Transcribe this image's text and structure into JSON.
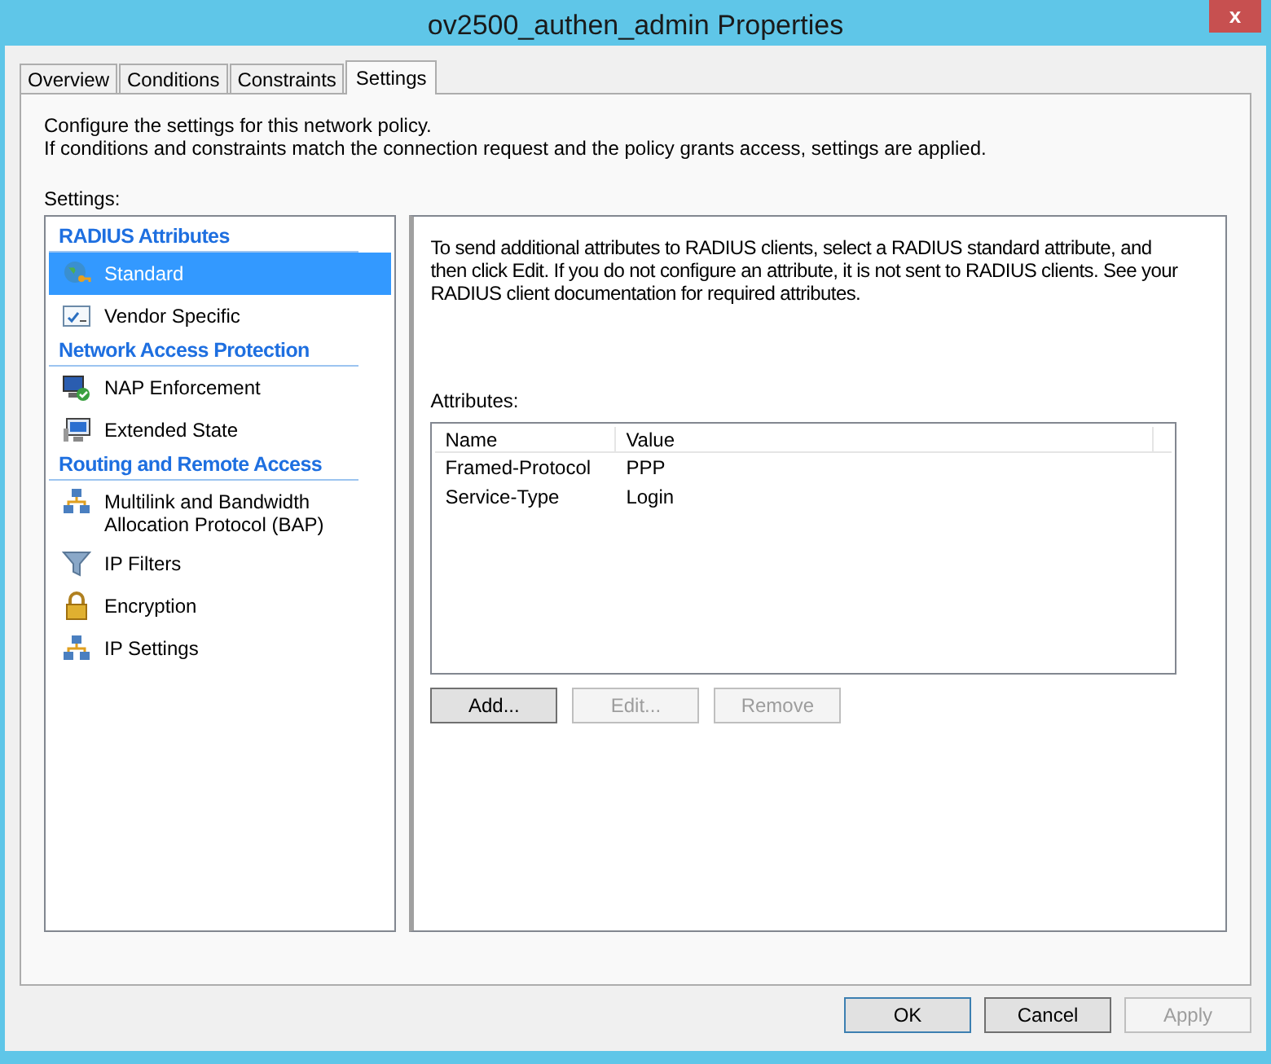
{
  "window": {
    "title": "ov2500_authen_admin Properties",
    "close": "x"
  },
  "tabs": [
    {
      "label": "Overview",
      "selected": false
    },
    {
      "label": "Conditions",
      "selected": false
    },
    {
      "label": "Constraints",
      "selected": false
    },
    {
      "label": "Settings",
      "selected": true
    }
  ],
  "intro": [
    "Configure the settings for this network policy.",
    "If conditions and constraints match the connection request and the policy grants access, settings are applied."
  ],
  "settings_label": "Settings:",
  "sidebar": {
    "groups": [
      {
        "heading": "RADIUS Attributes",
        "items": [
          {
            "label": "Standard",
            "selected": true
          },
          {
            "label": "Vendor Specific",
            "selected": false
          }
        ]
      },
      {
        "heading": "Network Access Protection",
        "items": [
          {
            "label": "NAP Enforcement",
            "selected": false
          },
          {
            "label": "Extended State",
            "selected": false
          }
        ]
      },
      {
        "heading": "Routing and Remote Access",
        "items": [
          {
            "label": "Multilink and Bandwidth Allocation Protocol (BAP)",
            "selected": false
          },
          {
            "label": "IP Filters",
            "selected": false
          },
          {
            "label": "Encryption",
            "selected": false
          },
          {
            "label": "IP Settings",
            "selected": false
          }
        ]
      }
    ]
  },
  "panel": {
    "description": "To send additional attributes to RADIUS clients, select a RADIUS standard attribute, and then click Edit. If you do not configure an attribute, it is not sent to RADIUS clients. See your RADIUS client documentation for required attributes.",
    "attributes_label": "Attributes:",
    "table": {
      "columns": [
        "Name",
        "Value"
      ],
      "rows": [
        [
          "Framed-Protocol",
          "PPP"
        ],
        [
          "Service-Type",
          "Login"
        ]
      ]
    },
    "buttons": [
      {
        "label": "Add...",
        "disabled": false
      },
      {
        "label": "Edit...",
        "disabled": true
      },
      {
        "label": "Remove",
        "disabled": true
      }
    ]
  },
  "footer_buttons": [
    {
      "label": "OK",
      "disabled": false,
      "default": true
    },
    {
      "label": "Cancel",
      "disabled": false,
      "default": false
    },
    {
      "label": "Apply",
      "disabled": true,
      "default": false
    }
  ]
}
